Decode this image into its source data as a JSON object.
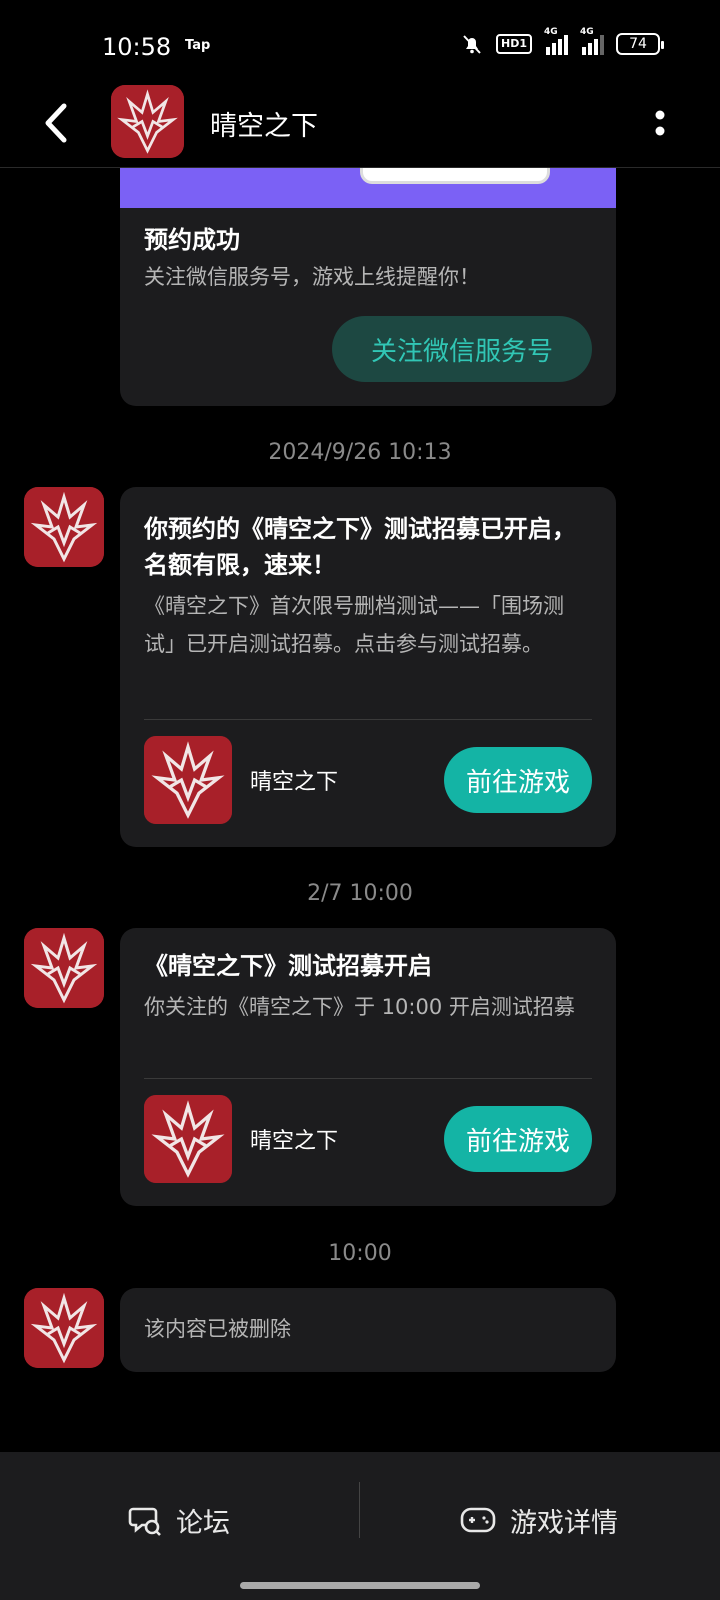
{
  "status_bar": {
    "time": "10:58",
    "tap_label": "Tap",
    "hd_label": "HD1",
    "signal1_label": "4G",
    "signal2_label": "4G",
    "battery": "74"
  },
  "header": {
    "title": "晴空之下"
  },
  "messages": {
    "top_card": {
      "title": "预约成功",
      "body": "关注微信服务号，游戏上线提醒你！",
      "button": "关注微信服务号"
    },
    "msg1": {
      "timestamp": "2024/9/26  10:13",
      "title": "你预约的《晴空之下》测试招募已开启，名额有限，速来！",
      "body": "《晴空之下》首次限号删档测试——「围场测试」已开启测试招募。点击参与测试招募。",
      "game_name": "晴空之下",
      "button": "前往游戏"
    },
    "msg2": {
      "timestamp": "2/7  10:00",
      "title": "《晴空之下》测试招募开启",
      "body": "你关注的《晴空之下》于 10:00 开启测试招募",
      "game_name": "晴空之下",
      "button": "前往游戏"
    },
    "msg3": {
      "timestamp": "10:00",
      "body": "该内容已被删除"
    }
  },
  "bottom_nav": {
    "forum": "论坛",
    "game_details": "游戏详情"
  },
  "colors": {
    "accent": "#14b4a5",
    "banner": "#7b61f5",
    "card": "#1c1c1e",
    "icon_red": "#9e1e26"
  }
}
